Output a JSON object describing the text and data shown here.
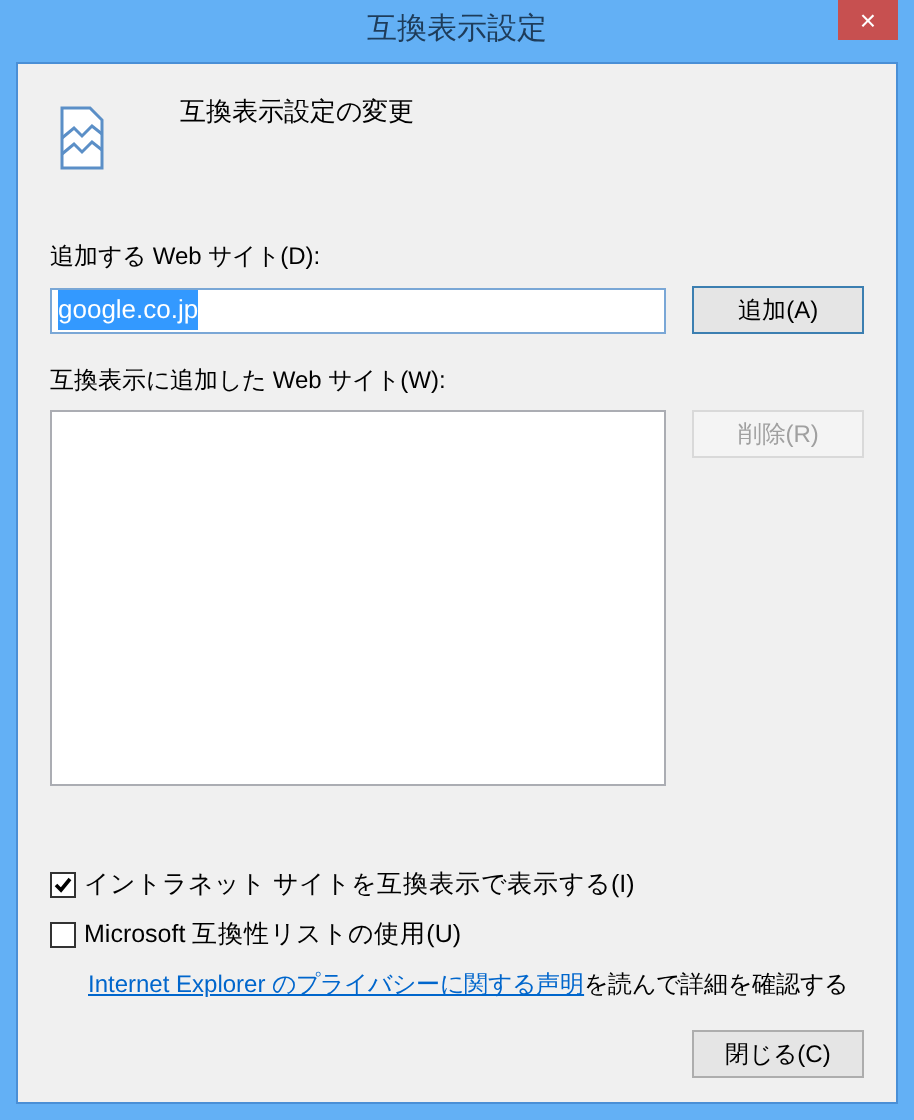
{
  "window": {
    "title": "互換表示設定",
    "close": "×"
  },
  "header": {
    "text": "互換表示設定の変更"
  },
  "add_site": {
    "label": "追加する Web サイト(D):",
    "value": "google.co.jp",
    "value_selected": true,
    "button": {
      "label": "追加(A)",
      "disabled": false
    }
  },
  "added_sites": {
    "label": "互換表示に追加した Web サイト(W):",
    "button": {
      "label": "削除(R)",
      "disabled": true
    }
  },
  "options": [
    {
      "label": "イントラネット サイトを互換表示で表示する(I)",
      "checked": true
    },
    {
      "label": "Microsoft 互換性リストの使用(U)",
      "checked": false
    }
  ],
  "privacy": {
    "link": "Internet Explorer のプライバシーに関する声明",
    "rest": "を読んで詳細を確認する"
  },
  "close_button": {
    "label": "閉じる(C)"
  }
}
